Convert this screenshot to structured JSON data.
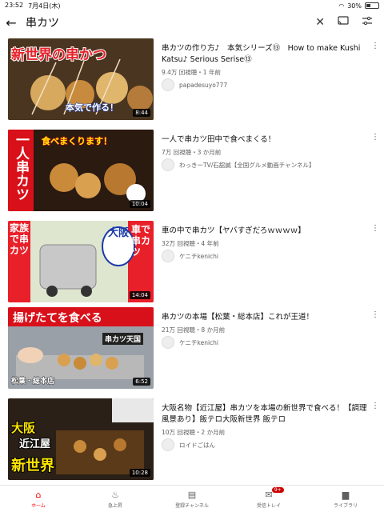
{
  "status": {
    "time": "23:52",
    "date": "7月4日(木)",
    "battery": "30%"
  },
  "search": {
    "query": "串カツ"
  },
  "videos": [
    {
      "title": "串カツの作り方♪　本気シリーズ⑬　How to make Kushi Katsu♪ Serious Serise⑬",
      "meta": "9.4万 回視聴・1 年前",
      "channel": "papadesuyo777",
      "duration": "8:44",
      "thumb_text": [
        "新世界の串かつ",
        "本気で作る！"
      ]
    },
    {
      "title": "一人で串カツ田中で食べまくる！",
      "meta": "7万 回視聴・3 か月前",
      "channel": "わっきーTV/石舘誠【全国グルメ動画チャンネル】",
      "duration": "10:04",
      "thumb_text": [
        "一人串カツ",
        "食べまくります！"
      ]
    },
    {
      "title": "車の中で串カツ【ヤバすぎだろｗｗｗｗ】",
      "meta": "32万 回視聴・4 年前",
      "channel": "ケニチkenichi",
      "duration": "14:04",
      "thumb_text": [
        "家族で串カツ",
        "大阪",
        "車で串カツ"
      ]
    },
    {
      "title": "串カツの本場【松葉・総本店】これが王道！",
      "meta": "21万 回視聴・8 か月前",
      "channel": "ケニチkenichi",
      "duration": "6:52",
      "thumb_text": [
        "揚げたてを食べる",
        "串カツ天国",
        "松葉・総本店"
      ]
    },
    {
      "title": "大阪名物【近江屋】串カツを本場の新世界で食べる！【調理風景あり】飯テロ大阪新世界 飯テロ",
      "meta": "10万 回視聴・2 か月前",
      "channel": "ロイドごはん",
      "duration": "10:28",
      "thumb_text": [
        "大阪",
        "近江屋",
        "新世界"
      ]
    }
  ],
  "tabbar": [
    {
      "label": "ホーム",
      "icon": "home-icon"
    },
    {
      "label": "急上昇",
      "icon": "flame-icon"
    },
    {
      "label": "登録チャンネル",
      "icon": "subscriptions-icon"
    },
    {
      "label": "受信トレイ",
      "icon": "inbox-icon",
      "badge": "9+"
    },
    {
      "label": "ライブラリ",
      "icon": "folder-icon"
    }
  ]
}
